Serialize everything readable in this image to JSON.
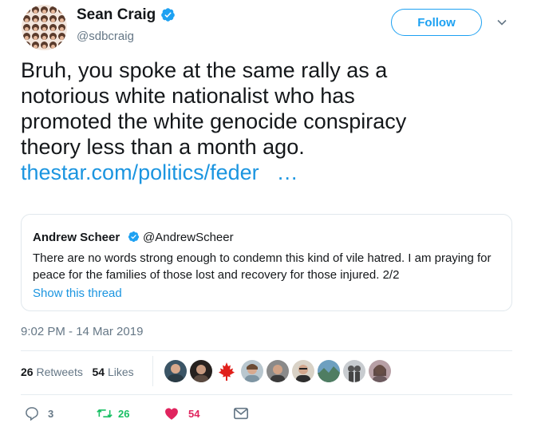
{
  "tweet": {
    "author_name": "Sean Craig",
    "author_handle": "@sdbcraig",
    "follow_label": "Follow",
    "text_lines": [
      "Bruh, you spoke at the same rally as a",
      "notorious white nationalist who has",
      "promoted the white genocide conspiracy",
      "theory less than a month ago."
    ],
    "link_text": "thestar.com/politics/feder",
    "link_ellipsis": "…",
    "timestamp": "9:02 PM - 14 Mar 2019"
  },
  "quote": {
    "author_name": "Andrew Scheer",
    "author_handle": "@AndrewScheer",
    "text": "There are no words strong enough to condemn this kind of vile hatred. I am praying for peace for the families of those lost and recovery for those injured. 2/2",
    "show_thread": "Show this thread"
  },
  "stats": {
    "retweets_count": "26",
    "retweets_label": "Retweets",
    "likes_count": "54",
    "likes_label": "Likes"
  },
  "actions": {
    "replies": "3",
    "retweets": "26",
    "likes": "54"
  },
  "colors": {
    "accent": "#1da1f2",
    "link": "#1b95e0",
    "secondary_text": "#657786",
    "retweet_green": "#17bf63",
    "like_red": "#e0245e",
    "maple_red": "#e0201b"
  },
  "icons": [
    "verified-badge-icon",
    "chevron-down-icon",
    "reply-icon",
    "retweet-icon",
    "heart-icon",
    "envelope-icon"
  ]
}
